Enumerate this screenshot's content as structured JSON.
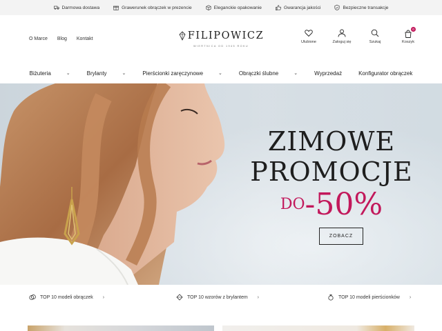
{
  "perks": [
    {
      "icon": "truck-icon",
      "label": "Darmowa dostawa"
    },
    {
      "icon": "gift-icon",
      "label": "Grawerunek obrączek w prezencie"
    },
    {
      "icon": "package-icon",
      "label": "Eleganckie opakowanie"
    },
    {
      "icon": "thumbs-up-icon",
      "label": "Gwarancja jakości"
    },
    {
      "icon": "shield-icon",
      "label": "Bezpieczne transakcje"
    }
  ],
  "header": {
    "links": [
      "O Marce",
      "Blog",
      "Kontakt"
    ],
    "brand": "FILIPOWICZ",
    "brand_tagline": "WIERTNICA OD 1945 ROKU",
    "tools": [
      {
        "icon": "heart-icon",
        "label": "Ulubione"
      },
      {
        "icon": "user-icon",
        "label": "Zaloguj się"
      },
      {
        "icon": "search-icon",
        "label": "Szukaj"
      },
      {
        "icon": "cart-icon",
        "label": "Koszyk",
        "badge": "0"
      }
    ]
  },
  "nav": [
    {
      "label": "Biżuteria",
      "has_dropdown": true
    },
    {
      "label": "Brylanty",
      "has_dropdown": true
    },
    {
      "label": "Pierścionki zaręczynowe",
      "has_dropdown": true
    },
    {
      "label": "Obrączki ślubne",
      "has_dropdown": true
    },
    {
      "label": "Wyprzedaż",
      "has_dropdown": false
    },
    {
      "label": "Konfigurator obrączek",
      "has_dropdown": false
    }
  ],
  "hero": {
    "line1": "ZIMOWE",
    "line2": "PROMOCJE",
    "prefix": "DO",
    "discount": "-50%",
    "cta": "ZOBACZ"
  },
  "top10": [
    {
      "icon": "rings-icon",
      "label": "TOP 10 modeli obrączek"
    },
    {
      "icon": "diamond-icon",
      "label": "TOP 10 wzorów z brylantem"
    },
    {
      "icon": "ring-icon",
      "label": "TOP 10 modeli pierścionków"
    }
  ],
  "colors": {
    "accent": "#c2185b",
    "text": "#222222",
    "perk_bar": "#f3f3f3"
  }
}
